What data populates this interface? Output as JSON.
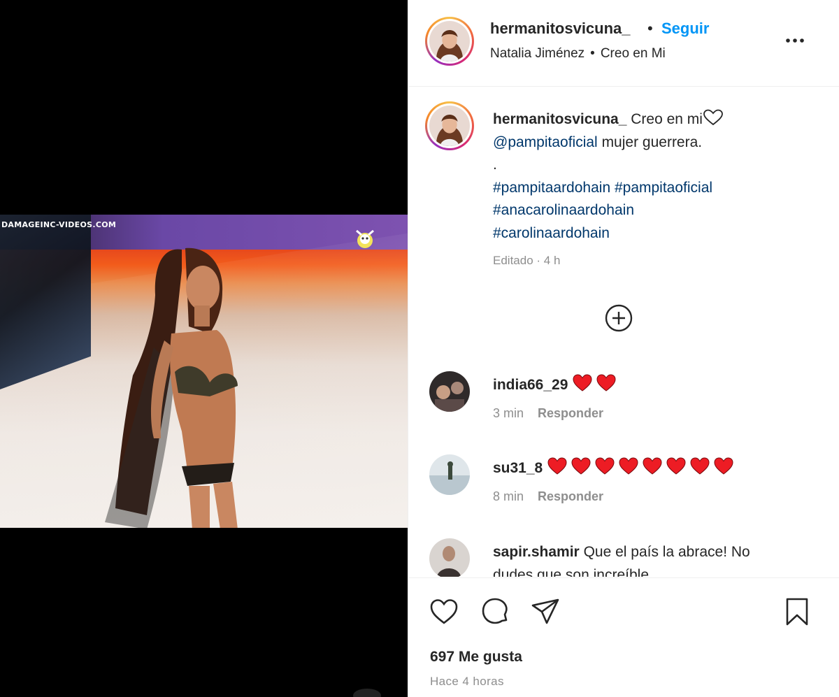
{
  "media": {
    "watermark": "DAMAGEINC-VIDEOS.COM"
  },
  "header": {
    "username": "hermanitosvicuna_",
    "separator": "•",
    "follow_label": "Seguir",
    "audio_artist": "Natalia Jiménez",
    "audio_sep": "•",
    "audio_title": "Creo en Mi"
  },
  "caption": {
    "username": "hermanitosvicuna_",
    "text_1": "Creo en mi",
    "mention": "@pampitaoficial",
    "text_2": "mujer guerrera.",
    "dot_line": ".",
    "hashtag_1": "#pampitaardohain",
    "hashtag_2": "#pampitaoficial",
    "hashtag_3": "#anacarolinaardohain",
    "hashtag_4": "#carolinaardohain",
    "meta": "Editado · 4 h"
  },
  "comments": [
    {
      "username": "india66_29",
      "text": "",
      "hearts": 2,
      "time": "3 min",
      "reply_label": "Responder"
    },
    {
      "username": "su31_8",
      "text": "",
      "hearts": 8,
      "time": "8 min",
      "reply_label": "Responder"
    },
    {
      "username": "sapir.shamir",
      "text_line1": "Que el país la abrace! No",
      "text_line2": "dudes que son increíble"
    }
  ],
  "actions": {
    "likes": "697 Me gusta",
    "time_ago": "Hace 4 horas"
  },
  "icons": {
    "more": "more-horizontal-icon",
    "load_more": "plus-circle-icon",
    "like": "heart-outline-icon",
    "comment": "comment-icon",
    "share": "share-paper-plane-icon",
    "save": "bookmark-icon"
  },
  "colors": {
    "accent": "#0095f6",
    "link": "#00376b",
    "muted": "#8e8e8e",
    "heart_red": "#ed1c24"
  }
}
